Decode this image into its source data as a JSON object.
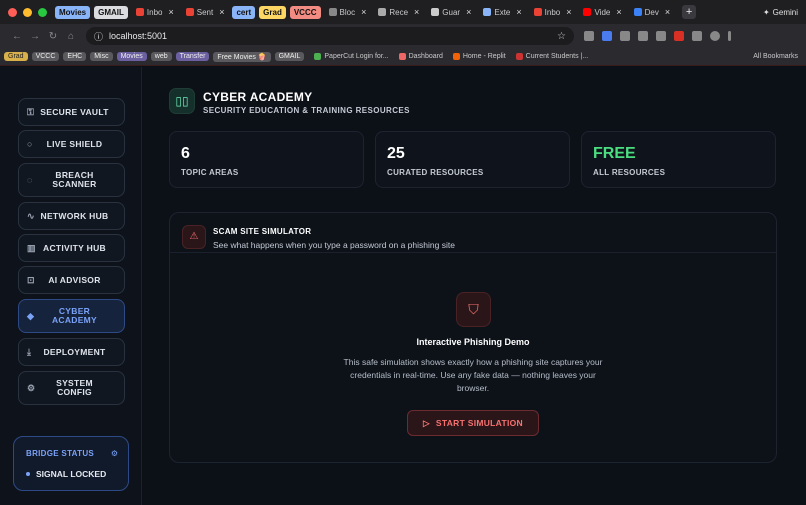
{
  "browser": {
    "tab_groups": [
      {
        "label": "Movies",
        "color": "#8ab4f8"
      },
      {
        "label": "GMAIL",
        "color": "#dadce0"
      },
      {
        "label": "cert",
        "color": "#8ab4f8"
      },
      {
        "label": "Grad",
        "color": "#fdd663"
      },
      {
        "label": "VCCC",
        "color": "#f28b82"
      }
    ],
    "tabs": [
      "Inbo",
      "Sent",
      "Bloc",
      "Rece",
      "Guar",
      "Exte",
      "Inbo",
      "Vide",
      "Dev"
    ],
    "url": "localhost:5001",
    "gemini_label": "Gemini",
    "bookmark_groups": [
      "Grad",
      "VCCC",
      "EHC",
      "Misc",
      "Movies",
      "web",
      "Transfer",
      "Free Movies 🍿",
      "GMAIL"
    ],
    "bookmark_links": [
      "PaperCut Login for...",
      "Dashboard",
      "Home - Replit",
      "Current Students |..."
    ],
    "all_bookmarks": "All Bookmarks"
  },
  "sidebar": {
    "items": [
      {
        "label": "SECURE VAULT",
        "icon": "key-icon",
        "glyph": "⚿"
      },
      {
        "label": "LIVE SHIELD",
        "icon": "search-icon",
        "glyph": "○"
      },
      {
        "label": "BREACH SCANNER",
        "icon": "shield-icon",
        "glyph": "◌"
      },
      {
        "label": "NETWORK HUB",
        "icon": "activity-icon",
        "glyph": "∿"
      },
      {
        "label": "ACTIVITY HUB",
        "icon": "bar-chart-icon",
        "glyph": "▥"
      },
      {
        "label": "AI ADVISOR",
        "icon": "bot-icon",
        "glyph": "⊡"
      },
      {
        "label": "CYBER ACADEMY",
        "icon": "graduation-cap-icon",
        "glyph": "◆"
      },
      {
        "label": "DEPLOYMENT",
        "icon": "download-icon",
        "glyph": "⤓"
      },
      {
        "label": "SYSTEM CONFIG",
        "icon": "gear-icon",
        "glyph": "⚙"
      }
    ],
    "active": "CYBER ACADEMY",
    "bridge": {
      "title": "BRIDGE STATUS",
      "status": "SIGNAL LOCKED"
    }
  },
  "header": {
    "title": "CYBER ACADEMY",
    "subtitle": "SECURITY EDUCATION & TRAINING RESOURCES"
  },
  "stats": [
    {
      "value": "6",
      "label": "TOPIC AREAS"
    },
    {
      "value": "25",
      "label": "CURATED RESOURCES"
    },
    {
      "value": "FREE",
      "label": "ALL RESOURCES",
      "accent": "#4ade80"
    }
  ],
  "simulator": {
    "title": "SCAM SITE SIMULATOR",
    "subtitle": "See what happens when you type a password on a phishing site",
    "demo_title": "Interactive Phishing Demo",
    "demo_text": "This safe simulation shows exactly how a phishing site captures your credentials in real-time. Use any fake data — nothing leaves your browser.",
    "button_label": "START SIMULATION"
  }
}
